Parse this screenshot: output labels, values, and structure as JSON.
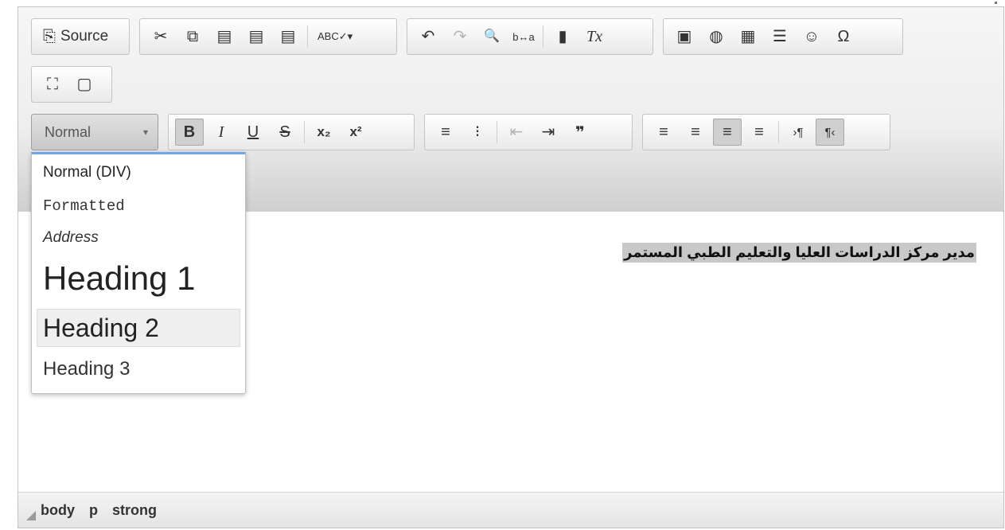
{
  "toolbar": {
    "source_label": "Source",
    "row1_icons_a": [
      "✂",
      "⧉",
      "▤",
      "▤",
      "▤"
    ],
    "spellcheck_icon": "ABC✓▾",
    "row1_icons_b": [
      "↶",
      "↷",
      "🔍",
      "b↔a"
    ],
    "row1_icons_c": [
      "▮",
      "Tx"
    ],
    "row1_icons_d": [
      "▣",
      "◍",
      "▦",
      "☰",
      "☺",
      "Ω"
    ],
    "row2_icons": [
      "⛶",
      "▢"
    ],
    "format_combo_value": "Normal",
    "basic": {
      "bold": "B",
      "italic": "I",
      "underline": "U",
      "strike": "S",
      "sub": "x₂",
      "sup": "x²"
    },
    "lists": {
      "numbered": "≡",
      "bulleted": "⁝",
      "outdent": "⇤",
      "indent": "⇥",
      "blockquote": "❞"
    },
    "align": {
      "left": "≡",
      "center": "≡",
      "right": "≡",
      "justify": "≡",
      "ltr": "›¶",
      "rtl": "¶‹"
    }
  },
  "format_dropdown": {
    "options": [
      "Normal (DIV)",
      "Formatted",
      "Address",
      "Heading 1",
      "Heading 2",
      "Heading 3"
    ],
    "hovered": "Heading 2"
  },
  "content": {
    "text": "مدير مركز الدراسات العليا والتعليم الطبي المستمر"
  },
  "statusbar": {
    "path": [
      "body",
      "p",
      "strong"
    ]
  },
  "colors": {
    "toolbar_bg": "#eeeeee",
    "dropdown_accent": "#6ea8e6",
    "selection_bg": "#c8c8c8"
  }
}
